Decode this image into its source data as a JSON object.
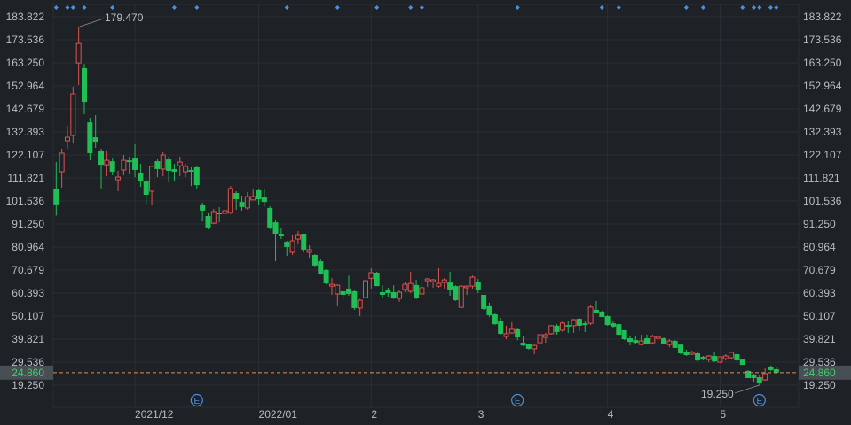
{
  "chart_data": {
    "type": "candlestick",
    "title": "",
    "xlabel": "",
    "ylabel": "",
    "ylim": [
      19.25,
      183.822
    ],
    "grid": true,
    "y_ticks": [
      "183.822",
      "173.536",
      "163.250",
      "152.964",
      "142.679",
      "132.393",
      "122.107",
      "111.821",
      "101.536",
      "91.250",
      "80.964",
      "70.679",
      "60.393",
      "50.107",
      "39.821",
      "29.536",
      "19.250"
    ],
    "x_ticks": [
      {
        "index": 14,
        "label": "2021/12"
      },
      {
        "index": 36,
        "label": "2022/01"
      },
      {
        "index": 56,
        "label": "2"
      },
      {
        "index": 75,
        "label": "3"
      },
      {
        "index": 98,
        "label": "4"
      },
      {
        "index": 118,
        "label": "5"
      }
    ],
    "current_price": {
      "value": 24.86,
      "label": "24.860"
    },
    "max_annotation": {
      "index": 4,
      "value": 179.47,
      "label": "179.470"
    },
    "min_annotation": {
      "index": 125,
      "value": 19.25,
      "label": "19.250"
    },
    "event_markers": {
      "indices": [
        25,
        82,
        125
      ],
      "label": "E"
    },
    "top_markers": [
      0,
      2,
      3,
      5,
      10,
      21,
      25,
      41,
      50,
      57,
      63,
      65,
      82,
      97,
      100,
      112,
      115,
      122,
      124,
      125,
      127,
      128
    ],
    "colors": {
      "up": "#e0524f",
      "down": "#1fbf56",
      "background": "#1e2125",
      "grid": "#2b2f35",
      "marker": "#4a90e2",
      "price_line": "#d9935a",
      "price_text": "#3ecf6a"
    },
    "candles_ohlc": [
      [
        107,
        119,
        95,
        100
      ],
      [
        114.6,
        124.9,
        107.5,
        122.9
      ],
      [
        128.4,
        135.1,
        124.9,
        130
      ],
      [
        130.8,
        152.6,
        127.2,
        149.4
      ],
      [
        163.2,
        179.47,
        153.4,
        171.9
      ],
      [
        160.9,
        162.8,
        140.3,
        145.8
      ],
      [
        136.7,
        138.7,
        119.7,
        122.9
      ],
      [
        130,
        139.9,
        125.3,
        128
      ],
      [
        123.7,
        124.9,
        107.1,
        117.7
      ],
      [
        117.7,
        124.1,
        112.6,
        119.7
      ],
      [
        119.3,
        120.5,
        113,
        114.6
      ],
      [
        111,
        115,
        105.9,
        112.2
      ],
      [
        115.4,
        122.1,
        113,
        119.7
      ],
      [
        119.7,
        121.3,
        113.4,
        118.9
      ],
      [
        120.5,
        126.8,
        112.2,
        115.4
      ],
      [
        114.2,
        118.1,
        107.9,
        110.6
      ],
      [
        110.6,
        111.4,
        99.9,
        104.3
      ],
      [
        105.9,
        117.3,
        99.9,
        117
      ],
      [
        119.3,
        120.1,
        112.2,
        115.8
      ],
      [
        115.8,
        123.3,
        112.6,
        122.1
      ],
      [
        120.1,
        121.3,
        109.8,
        115
      ],
      [
        115.8,
        118.1,
        110.6,
        114.6
      ],
      [
        117.3,
        121.3,
        112.6,
        118.9
      ],
      [
        114.6,
        118.1,
        112.2,
        117
      ],
      [
        115.4,
        116.6,
        108.2,
        114.6
      ],
      [
        116.6,
        116.9,
        106.7,
        108.6
      ],
      [
        100,
        100.8,
        92.4,
        97.2
      ],
      [
        94.8,
        96.4,
        88.9,
        89.7
      ],
      [
        91.6,
        98,
        91.2,
        96.8
      ],
      [
        96.4,
        98.8,
        92,
        95.6
      ],
      [
        96,
        98,
        93.2,
        97.2
      ],
      [
        96.4,
        108.2,
        95.6,
        107.1
      ],
      [
        105.1,
        105.9,
        97.6,
        102.3
      ],
      [
        101.1,
        103.9,
        97.2,
        98.8
      ],
      [
        98.4,
        105.5,
        97.6,
        103.5
      ],
      [
        102,
        106.7,
        102,
        103.5
      ],
      [
        106.3,
        106.7,
        99.9,
        102.3
      ],
      [
        103.1,
        106.7,
        99.1,
        101.1
      ],
      [
        98.4,
        99.1,
        88.9,
        89.7
      ],
      [
        92,
        92.8,
        74.6,
        86.9
      ],
      [
        86.9,
        89.3,
        84.5,
        85.7
      ],
      [
        83.3,
        83.7,
        77,
        81
      ],
      [
        78.6,
        86.5,
        77.4,
        83.7
      ],
      [
        84.5,
        88.1,
        82.1,
        86.5
      ],
      [
        86.9,
        86.9,
        78.6,
        79.8
      ],
      [
        78.6,
        81.8,
        76.2,
        79.8
      ],
      [
        77.4,
        77.8,
        72.3,
        72.7
      ],
      [
        74.6,
        75.8,
        68.6,
        69
      ],
      [
        70.7,
        71.1,
        64.3,
        64.7
      ],
      [
        63.5,
        67.1,
        59.6,
        64.3
      ],
      [
        60,
        64.3,
        54.5,
        63.9
      ],
      [
        61.2,
        61.6,
        57.7,
        59.6
      ],
      [
        62.4,
        68.2,
        59.2,
        60
      ],
      [
        61.2,
        61.6,
        52.9,
        53.7
      ],
      [
        53.7,
        57.7,
        50.1,
        57.2
      ],
      [
        58.4,
        66.3,
        58,
        65.9
      ],
      [
        67,
        71.5,
        62.4,
        69.5
      ],
      [
        69.5,
        69.9,
        63.5,
        63.5
      ],
      [
        60.8,
        63.9,
        58,
        59.6
      ],
      [
        62,
        62.8,
        58.8,
        60.4
      ],
      [
        60.8,
        63.9,
        57.7,
        58
      ],
      [
        58,
        61.6,
        56.5,
        60.8
      ],
      [
        62,
        65.5,
        60.8,
        64.3
      ],
      [
        61.2,
        69.9,
        60.4,
        64.7
      ],
      [
        64,
        66.3,
        57.7,
        58.4
      ],
      [
        60,
        66.3,
        59.6,
        62.8
      ],
      [
        65.9,
        67.1,
        63.1,
        66.7
      ],
      [
        65.5,
        66.7,
        62.8,
        66.3
      ],
      [
        63.5,
        71.5,
        62.8,
        64.7
      ],
      [
        65.1,
        67.1,
        62.4,
        66.3
      ],
      [
        65.1,
        69.9,
        59.2,
        62
      ],
      [
        63.5,
        63.9,
        56.9,
        57.2
      ],
      [
        54,
        63.9,
        53.7,
        63.5
      ],
      [
        62.8,
        63.9,
        59.6,
        63.5
      ],
      [
        63.5,
        68.2,
        62.4,
        67.5
      ],
      [
        65.5,
        66.7,
        60.4,
        61.6
      ],
      [
        59.6,
        59.6,
        52.9,
        53.3
      ],
      [
        54.5,
        56.1,
        49.7,
        50.5
      ],
      [
        50.9,
        51.3,
        46.1,
        46.5
      ],
      [
        48.1,
        49.3,
        41.8,
        42.2
      ],
      [
        41,
        45.8,
        39.8,
        42.2
      ],
      [
        42.6,
        47.4,
        42.2,
        44.2
      ],
      [
        44.2,
        44.6,
        39.4,
        40.6
      ],
      [
        38.2,
        41,
        36.6,
        37
      ],
      [
        37.8,
        37.8,
        35.1,
        35.5
      ],
      [
        35.5,
        37.4,
        33.1,
        37
      ],
      [
        38.2,
        42.2,
        37.8,
        41.8
      ],
      [
        40.6,
        42.6,
        38.2,
        41.8
      ],
      [
        42.2,
        46.1,
        41.8,
        45.8
      ],
      [
        45.8,
        46.5,
        41.8,
        43
      ],
      [
        43.8,
        48.1,
        43,
        47
      ],
      [
        46.1,
        47.7,
        42.6,
        45.4
      ],
      [
        45.8,
        48.9,
        42.6,
        48.5
      ],
      [
        48.9,
        49.3,
        43.4,
        45.8
      ],
      [
        46.9,
        48.1,
        43,
        46.1
      ],
      [
        46.9,
        54.9,
        46.1,
        54.1
      ],
      [
        52.9,
        56.8,
        51.7,
        51.7
      ],
      [
        52.1,
        52.5,
        49.7,
        49.7
      ],
      [
        50.1,
        50.5,
        45.8,
        46.1
      ],
      [
        46.9,
        47.7,
        44.6,
        45.4
      ],
      [
        46.5,
        46.9,
        41.4,
        41.8
      ],
      [
        43.8,
        43.8,
        39.4,
        39.8
      ],
      [
        40.2,
        41.4,
        37,
        38.6
      ],
      [
        39.4,
        41,
        37.8,
        38.2
      ],
      [
        37.4,
        41.8,
        37,
        39
      ],
      [
        40.2,
        41.8,
        37.4,
        37.8
      ],
      [
        38.2,
        41.8,
        37.8,
        41
      ],
      [
        40.2,
        41.8,
        39,
        41
      ],
      [
        40.2,
        40.6,
        37.4,
        37.8
      ],
      [
        37.4,
        39.8,
        36.2,
        39
      ],
      [
        39,
        39.4,
        35.9,
        35.9
      ],
      [
        37.4,
        37.8,
        33.1,
        33.5
      ],
      [
        34.3,
        35.1,
        32.3,
        32.7
      ],
      [
        33.1,
        34.7,
        32.7,
        33.9
      ],
      [
        33.5,
        33.9,
        29.9,
        30.3
      ],
      [
        31.9,
        32.3,
        30.3,
        30.7
      ],
      [
        30.7,
        32.7,
        29.5,
        32.3
      ],
      [
        32.3,
        33.9,
        29.5,
        29.9
      ],
      [
        29.5,
        31.9,
        29.1,
        31.9
      ],
      [
        31.1,
        33.1,
        30.3,
        32.3
      ],
      [
        31.5,
        34.3,
        30.7,
        33.9
      ],
      [
        33.1,
        33.5,
        29.5,
        30.3
      ],
      [
        30.7,
        31.1,
        28.3,
        28.3
      ],
      [
        25.6,
        26,
        22.4,
        22.4
      ],
      [
        24,
        24.4,
        20.8,
        22.4
      ],
      [
        22.8,
        23.6,
        19.25,
        20
      ],
      [
        21.6,
        26.8,
        21.2,
        24.4
      ],
      [
        27.6,
        28,
        25.6,
        26
      ],
      [
        26.4,
        27.2,
        24.4,
        24.86
      ]
    ]
  }
}
